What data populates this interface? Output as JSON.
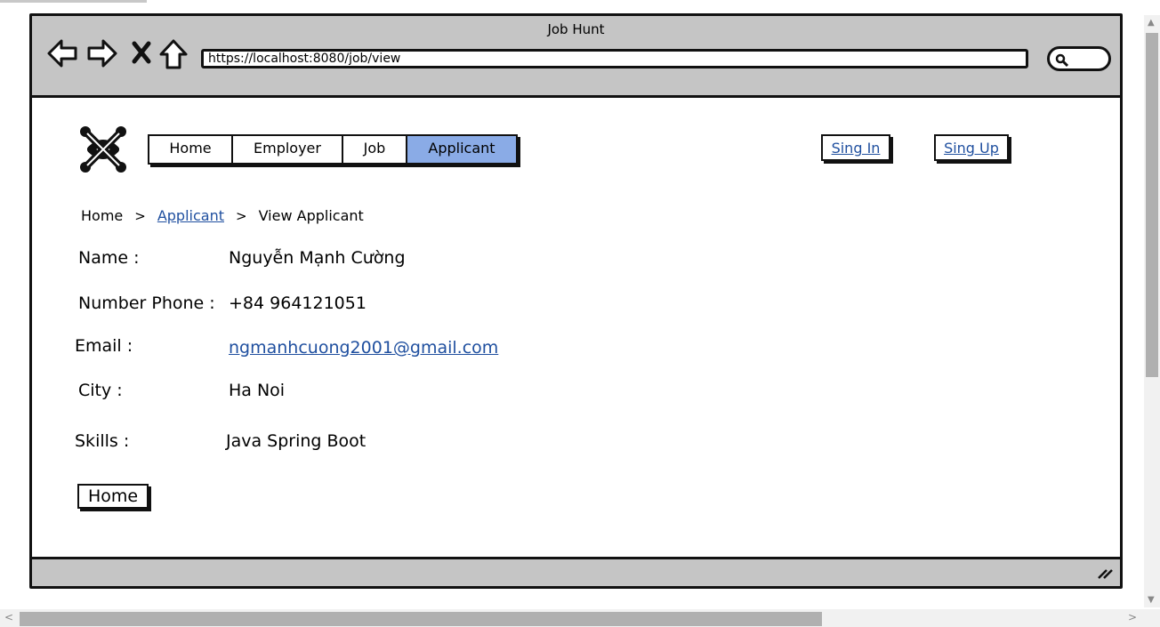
{
  "window": {
    "title": "Job Hunt",
    "url": "https://localhost:8080/job/view"
  },
  "nav": {
    "items": [
      {
        "label": "Home",
        "active": false
      },
      {
        "label": "Employer",
        "active": false
      },
      {
        "label": "Job",
        "active": false
      },
      {
        "label": "Applicant",
        "active": true
      }
    ],
    "sign_in": "Sing In",
    "sign_up": "Sing Up"
  },
  "breadcrumb": {
    "home": "Home",
    "sep1": ">",
    "section": "Applicant",
    "sep2": ">",
    "current": "View Applicant"
  },
  "applicant": {
    "name_label": "Name :",
    "name": "Nguyễn Mạnh Cường",
    "phone_label": "Number Phone :",
    "phone": "+84 964121051",
    "email_label": "Email :",
    "email": "ngmanhcuong2001@gmail.com",
    "city_label": "City :",
    "city": "Ha Noi",
    "skills_label": "Skills :",
    "skills": "Java Spring Boot"
  },
  "actions": {
    "home_button": "Home"
  },
  "colors": {
    "active_tab": "#8aabe6",
    "link": "#1f4f9f",
    "chrome": "#c5c5c5"
  }
}
